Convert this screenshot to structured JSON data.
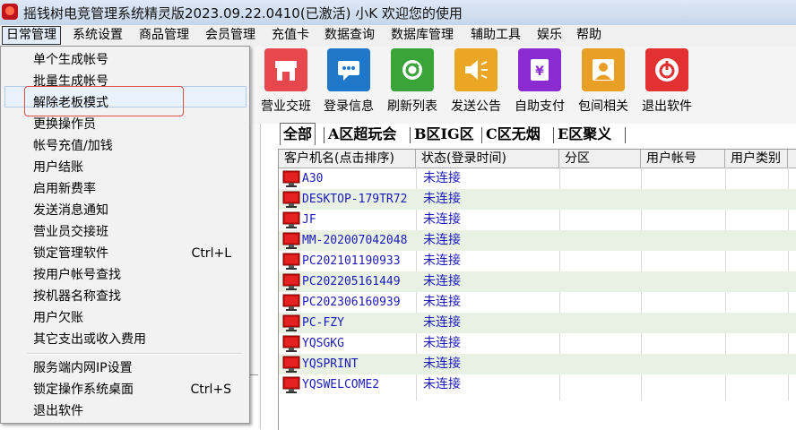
{
  "window": {
    "title": "摇钱树电竞管理系统精灵版2023.09.22.0410(已激活)  小K 欢迎您的使用"
  },
  "menubar": {
    "items": [
      "日常管理",
      "系统设置",
      "商品管理",
      "会员管理",
      "充值卡",
      "数据查询",
      "数据库管理",
      "辅助工具",
      "娱乐",
      "帮助"
    ]
  },
  "toolbar": {
    "buttons": [
      {
        "label": "营业交班",
        "color": "#e8474d",
        "icon": "shop-icon"
      },
      {
        "label": "登录信息",
        "color": "#1e77c9",
        "icon": "chat-icon"
      },
      {
        "label": "刷新列表",
        "color": "#3aa33a",
        "icon": "refresh-icon"
      },
      {
        "label": "发送公告",
        "color": "#eba623",
        "icon": "speaker-icon"
      },
      {
        "label": "自助支付",
        "color": "#8a2bd0",
        "icon": "yen-icon"
      },
      {
        "label": "包间相关",
        "color": "#e99f25",
        "icon": "user-icon"
      },
      {
        "label": "退出软件",
        "color": "#e33131",
        "icon": "power-icon"
      }
    ]
  },
  "dropdown": {
    "items": [
      {
        "label": "单个生成帐号",
        "shortcut": ""
      },
      {
        "label": "批量生成帐号",
        "shortcut": ""
      },
      {
        "label": "解除老板模式",
        "shortcut": ""
      },
      {
        "label": "更换操作员",
        "shortcut": ""
      },
      {
        "label": "帐号充值/加钱",
        "shortcut": ""
      },
      {
        "label": "用户结账",
        "shortcut": ""
      },
      {
        "label": "启用新费率",
        "shortcut": ""
      },
      {
        "label": "发送消息通知",
        "shortcut": ""
      },
      {
        "label": "营业员交接班",
        "shortcut": ""
      },
      {
        "label": "锁定管理软件",
        "shortcut": "Ctrl+L"
      },
      {
        "label": "按用户帐号查找",
        "shortcut": ""
      },
      {
        "label": "按机器名称查找",
        "shortcut": ""
      },
      {
        "label": "用户欠账",
        "shortcut": ""
      },
      {
        "label": "其它支出或收入费用",
        "shortcut": ""
      },
      {
        "label": "服务端内网IP设置",
        "shortcut": ""
      },
      {
        "label": "锁定操作系统桌面",
        "shortcut": "Ctrl+S"
      },
      {
        "label": "退出软件",
        "shortcut": ""
      }
    ]
  },
  "tabs": [
    "全部",
    "A区超玩会",
    "B区IG区",
    "C区无烟",
    "E区聚义"
  ],
  "table": {
    "headers": [
      "客户机名(点击排序)",
      "状态(登录时间)",
      "分区",
      "用户帐号",
      "用户类别"
    ],
    "rows": [
      {
        "name": "A30",
        "status": "未连接"
      },
      {
        "name": "DESKTOP-179TR72",
        "status": "未连接"
      },
      {
        "name": "JF",
        "status": "未连接"
      },
      {
        "name": "MM-202007042048",
        "status": "未连接"
      },
      {
        "name": "PC202101190933",
        "status": "未连接"
      },
      {
        "name": "PC202205161449",
        "status": "未连接"
      },
      {
        "name": "PC202306160939",
        "status": "未连接"
      },
      {
        "name": "PC-FZY",
        "status": "未连接"
      },
      {
        "name": "YQSGKG",
        "status": "未连接"
      },
      {
        "name": "YQSPRINT",
        "status": "未连接"
      },
      {
        "name": "YQSWELCOME2",
        "status": "未连接"
      }
    ]
  }
}
